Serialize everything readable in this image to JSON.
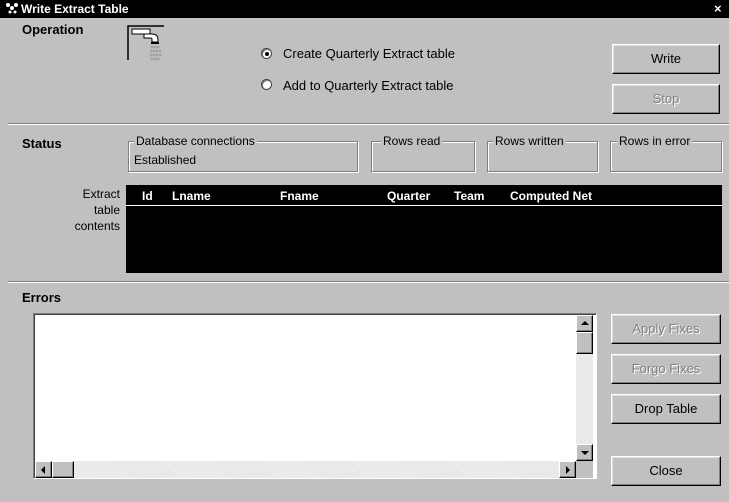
{
  "window": {
    "title": "Write Extract Table",
    "close_glyph": "×"
  },
  "operation": {
    "label": "Operation",
    "icon": "faucet-icon",
    "options": [
      {
        "label": "Create Quarterly Extract table",
        "mnemonic": "r",
        "selected": true
      },
      {
        "label": "Add to Quarterly Extract table",
        "mnemonic": "t",
        "selected": false
      }
    ]
  },
  "buttons": {
    "write": {
      "label": "Write",
      "mnemonic": "W",
      "enabled": true
    },
    "stop": {
      "label": "Stop",
      "mnemonic": "S",
      "enabled": false
    },
    "apply_fixes": {
      "label": "Apply Fixes",
      "mnemonic": "A",
      "enabled": false
    },
    "forgo_fixes": {
      "label": "Forgo Fixes",
      "mnemonic": "F",
      "enabled": false
    },
    "drop_table": {
      "label": "Drop Table",
      "mnemonic": "D",
      "enabled": true
    },
    "close": {
      "label": "Close",
      "mnemonic": "C",
      "enabled": true
    }
  },
  "status": {
    "label": "Status",
    "database_connections": {
      "title": "Database connections",
      "value": "Established"
    },
    "rows_read": {
      "title": "Rows read",
      "value": ""
    },
    "rows_written": {
      "title": "Rows written",
      "value": ""
    },
    "rows_in_error": {
      "title": "Rows in error",
      "value": ""
    }
  },
  "extract": {
    "label": "Extract table contents",
    "columns": [
      "Id",
      "Lname",
      "Fname",
      "Quarter",
      "Team",
      "Computed Net"
    ],
    "rows": []
  },
  "errors": {
    "label": "Errors",
    "text": ""
  },
  "colors": {
    "window_bg": "#c0c0c0",
    "titlebar_bg": "#000000",
    "table_bg": "#000000"
  }
}
